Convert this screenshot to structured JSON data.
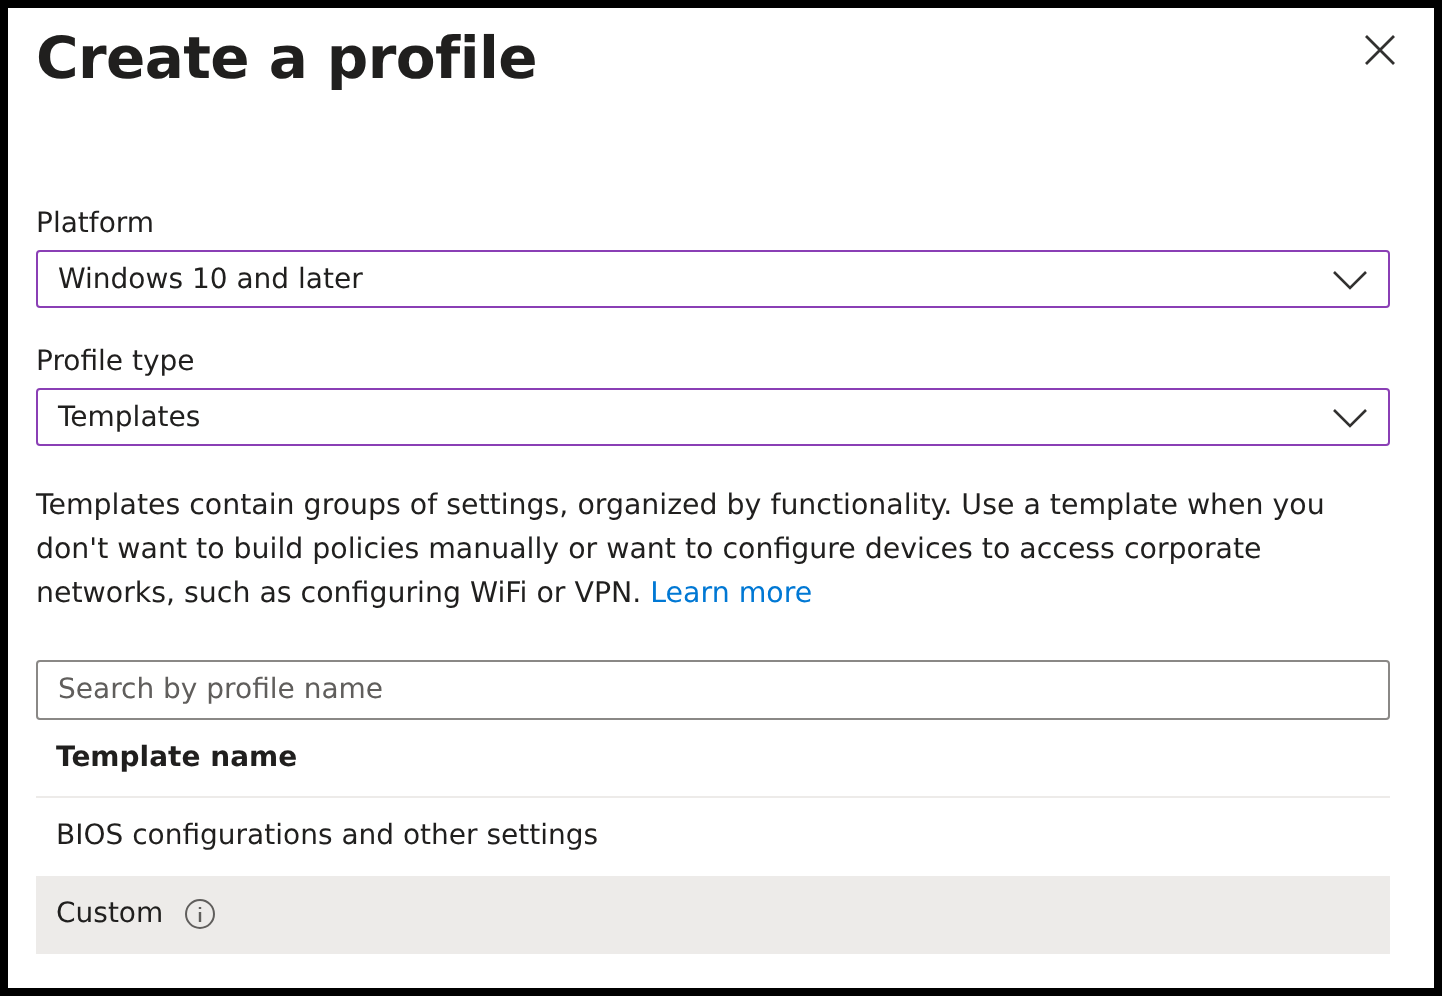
{
  "title": "Create a profile",
  "fields": [
    {
      "label": "Platform",
      "value": "Windows 10 and later"
    },
    {
      "label": "Profile type",
      "value": "Templates"
    }
  ],
  "description": "Templates contain groups of settings, organized by functionality. Use a template when you don't want to build policies manually or want to configure devices to access corporate networks, such as configuring WiFi or VPN.",
  "learn_more": "Learn more",
  "search": {
    "placeholder": "Search by profile name"
  },
  "table": {
    "columns": [
      "Template name"
    ],
    "rows": [
      {
        "name": "BIOS configurations and other settings",
        "info": false,
        "selected": false
      },
      {
        "name": "Custom",
        "info": true,
        "selected": true
      }
    ]
  }
}
